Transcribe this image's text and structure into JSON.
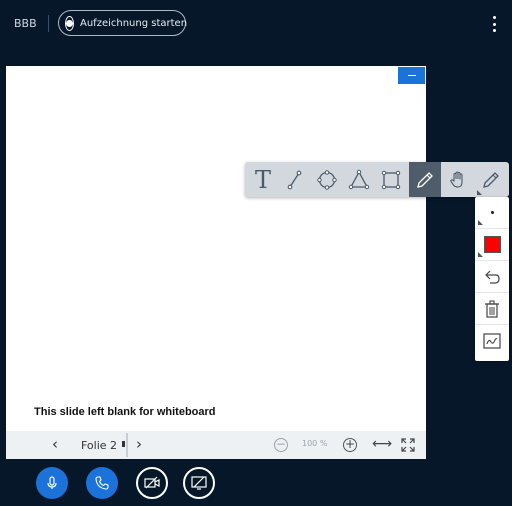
{
  "header": {
    "app_title": "BBB",
    "record_label": "Aufzeichnung starten"
  },
  "presentation": {
    "slide_text": "This slide left blank for whiteboard",
    "current_slide": "Folie 2",
    "zoom": "100 %"
  },
  "whiteboard": {
    "tools": [
      "text-tool",
      "line-tool",
      "ellipse-tool",
      "triangle-tool",
      "rectangle-tool",
      "pencil-tool",
      "hand-tool",
      "pencil-tool"
    ],
    "active_tool": "pencil-tool",
    "active_color": "#ff0000"
  },
  "controls": {
    "mic": "microphone-icon",
    "audio": "phone-icon",
    "video": "video-off-icon",
    "screenshare": "screenshare-off-icon"
  },
  "colors": {
    "background": "#06172a",
    "primary": "#1b73d9",
    "toolbar": "#d3d8de"
  }
}
